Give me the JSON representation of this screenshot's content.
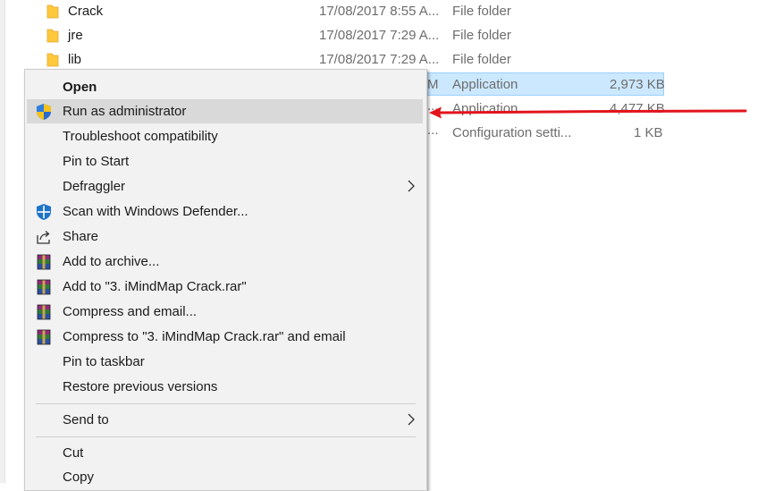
{
  "files": [
    {
      "name": "Crack",
      "date": "17/08/2017 8:55 A...",
      "type": "File folder",
      "size": ""
    },
    {
      "name": "jre",
      "date": "17/08/2017 7:29 A...",
      "type": "File folder",
      "size": ""
    },
    {
      "name": "lib",
      "date": "17/08/2017 7:29 A...",
      "type": "File folder",
      "size": ""
    }
  ],
  "partial_rows": [
    {
      "date_tail": "M",
      "type": "Application",
      "size": "2,973 KB"
    },
    {
      "date_tail": "...",
      "type": "Application",
      "size": "4,477 KB"
    },
    {
      "date_tail": "...",
      "type": "Configuration setti...",
      "size": "1 KB"
    }
  ],
  "context_menu": {
    "items": [
      {
        "label": "Open",
        "icon": ""
      },
      {
        "label": "Run as administrator",
        "icon": "uac-shield-icon"
      },
      {
        "label": "Troubleshoot compatibility",
        "icon": ""
      },
      {
        "label": "Pin to Start",
        "icon": ""
      },
      {
        "label": "Defraggler",
        "icon": "",
        "submenu": true
      },
      {
        "label": "Scan with Windows Defender...",
        "icon": "windows-defender-icon"
      },
      {
        "label": "Share",
        "icon": "share-icon"
      },
      {
        "label": "Add to archive...",
        "icon": "winrar-icon"
      },
      {
        "label": "Add to \"3. iMindMap Crack.rar\"",
        "icon": "winrar-icon"
      },
      {
        "label": "Compress and email...",
        "icon": "winrar-icon"
      },
      {
        "label": "Compress to \"3. iMindMap Crack.rar\" and email",
        "icon": "winrar-icon"
      },
      {
        "label": "Pin to taskbar",
        "icon": ""
      },
      {
        "label": "Restore previous versions",
        "icon": ""
      },
      {
        "label": "Send to",
        "icon": "",
        "submenu": true
      },
      {
        "label": "Cut",
        "icon": ""
      },
      {
        "label": "Copy",
        "icon": ""
      }
    ]
  },
  "colors": {
    "selection_bg": "#cce8ff",
    "menu_hover": "#d9d9d9",
    "annotation_arrow": "#e3141d",
    "folder_yellow": "#ffc83d"
  }
}
